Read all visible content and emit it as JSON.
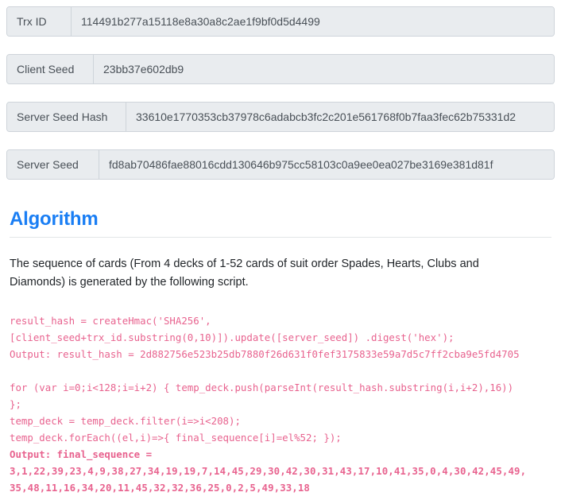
{
  "fields": [
    {
      "label": "Trx ID",
      "value": "114491b277a15118e8a30a8c2ae1f9bf0d5d4499"
    },
    {
      "label": "Client Seed",
      "value": "23bb37e602db9"
    },
    {
      "label": "Server Seed Hash",
      "value": "33610e1770353cb37978c6adabcb3fc2c201e561768f0b7faa3fec62b75331d2"
    },
    {
      "label": "Server Seed",
      "value": "fd8ab70486fae88016cdd130646b975cc58103c0a9ee0ea027be3169e381d81f"
    }
  ],
  "algorithm": {
    "heading": "Algorithm",
    "description": "The sequence of cards (From 4 decks of 1-52 cards of suit order Spades, Hearts, Clubs and Diamonds) is generated by the following script.",
    "code_lines": [
      "result_hash = createHmac('SHA256',",
      "[client_seed+trx_id.substring(0,10)]).update([server_seed]) .digest('hex');",
      "Output: result_hash = 2d882756e523b25db7880f26d631f0fef3175833e59a7d5c7ff2cba9e5fd4705",
      "",
      "for (var i=0;i<128;i=i+2) { temp_deck.push(parseInt(result_hash.substring(i,i+2),16))",
      "};",
      "temp_deck = temp_deck.filter(i=>i<208);",
      "temp_deck.forEach((el,i)=>{ final_sequence[i]=el%52; });"
    ],
    "output_label": "Output: final_sequence =",
    "sequence_line_1": "3,1,22,39,23,4,9,38,27,34,19,19,7,14,45,29,30,42,30,31,43,17,10,41,35,0,4,30,42,45,49,",
    "sequence_line_2": "35,48,11,16,34,20,11,45,32,32,36,25,0,2,5,49,33,18"
  },
  "colors": {
    "accent": "#1a7ef4",
    "code": "#e8638f",
    "field_bg": "#e9ecef",
    "field_border": "#ced4da"
  }
}
